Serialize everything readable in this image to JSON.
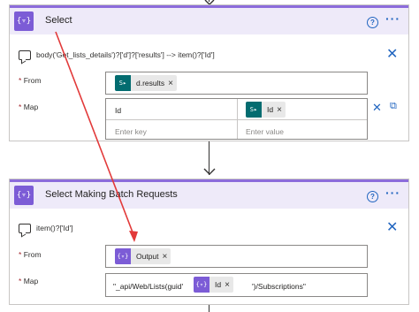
{
  "actions": [
    {
      "title": "Select",
      "comment": "body('Get_lists_details')?['d']?['results'] --> item()?['Id']",
      "from_label": "From",
      "from_token": "d.results",
      "map_label": "Map",
      "map_key": "Id",
      "map_value_token": "Id",
      "key_placeholder": "Enter key",
      "value_placeholder": "Enter value"
    },
    {
      "title": "Select Making Batch Requests",
      "comment": "item()?['Id']",
      "from_label": "From",
      "from_token": "Output",
      "map_label": "Map",
      "map_text_before": "\"_api/Web/Lists(guid'",
      "map_token": "Id",
      "map_text_after": "')/Subscriptions\""
    }
  ],
  "icons": {
    "action_icon": "{▿}",
    "sharepoint_icon": "S▸",
    "help": "?",
    "more": "···",
    "close": "✕",
    "token_remove": "×",
    "delete": "✕",
    "copy": "⧉",
    "required": "*"
  },
  "colors": {
    "header_bg": "#eeeaf9",
    "header_accent": "#8c6cdb",
    "action_icon_bg": "#7c5cd6",
    "sharepoint": "#036c70",
    "link_blue": "#2266c0",
    "annotation_red": "#e23a3a"
  }
}
